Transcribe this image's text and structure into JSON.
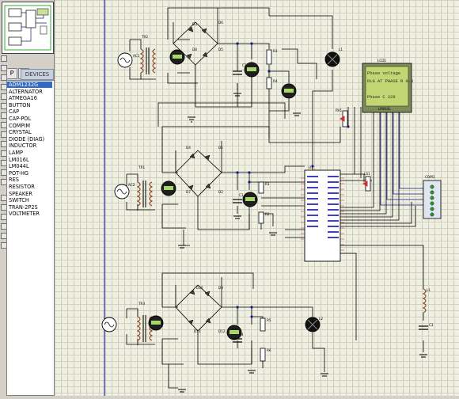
{
  "sidebar": {
    "mode_buttons": [
      "P",
      "L"
    ],
    "devices_header": "DEVICES",
    "devices": [
      "ADM1232G",
      "ALTERNATOR",
      "ATMEGA16",
      "BUTTON",
      "CAP",
      "CAP-POL",
      "COMPIM",
      "CRYSTAL",
      "DIODE (DIAG)",
      "INDUCTOR",
      "LAMP",
      "LM016L",
      "LM044L",
      "POT-HG",
      "RES",
      "RESISTOR",
      "SPEAKER",
      "SWITCH",
      "TRAN-2P2S",
      "VOLTMETER"
    ],
    "selected_index": 0
  },
  "schematic": {
    "lcd": {
      "ref": "LCD1",
      "line1": "Phase voltage",
      "line2": "DLG AT PHASE R 0.0",
      "line3": "",
      "line4": "Phase C   229",
      "bottom_text": "LM044L"
    },
    "labels": {
      "tr1": "TR1",
      "tr2": "TR2",
      "tr3": "TR3",
      "ac1": "AC1",
      "ac2": "AC2",
      "d1": "D1",
      "d2": "D2",
      "d3": "D3",
      "d4": "D4",
      "d5": "D5",
      "d6": "D6",
      "d7": "D7",
      "d8": "D8",
      "d9": "D9",
      "d10": "D10",
      "d11": "D11",
      "d12": "D12",
      "c1": "C1",
      "c2": "C2",
      "c3": "C3",
      "c4": "C4",
      "r1": "R1",
      "r2": "R2",
      "r3": "R3",
      "r4": "R4",
      "r5": "R5",
      "r6": "R6",
      "rv1": "RV1",
      "l1": "L1",
      "l2": "L2",
      "u1": "U1",
      "ls1": "LS1",
      "com1": "COM1",
      "lamp_l1": "L1"
    }
  }
}
